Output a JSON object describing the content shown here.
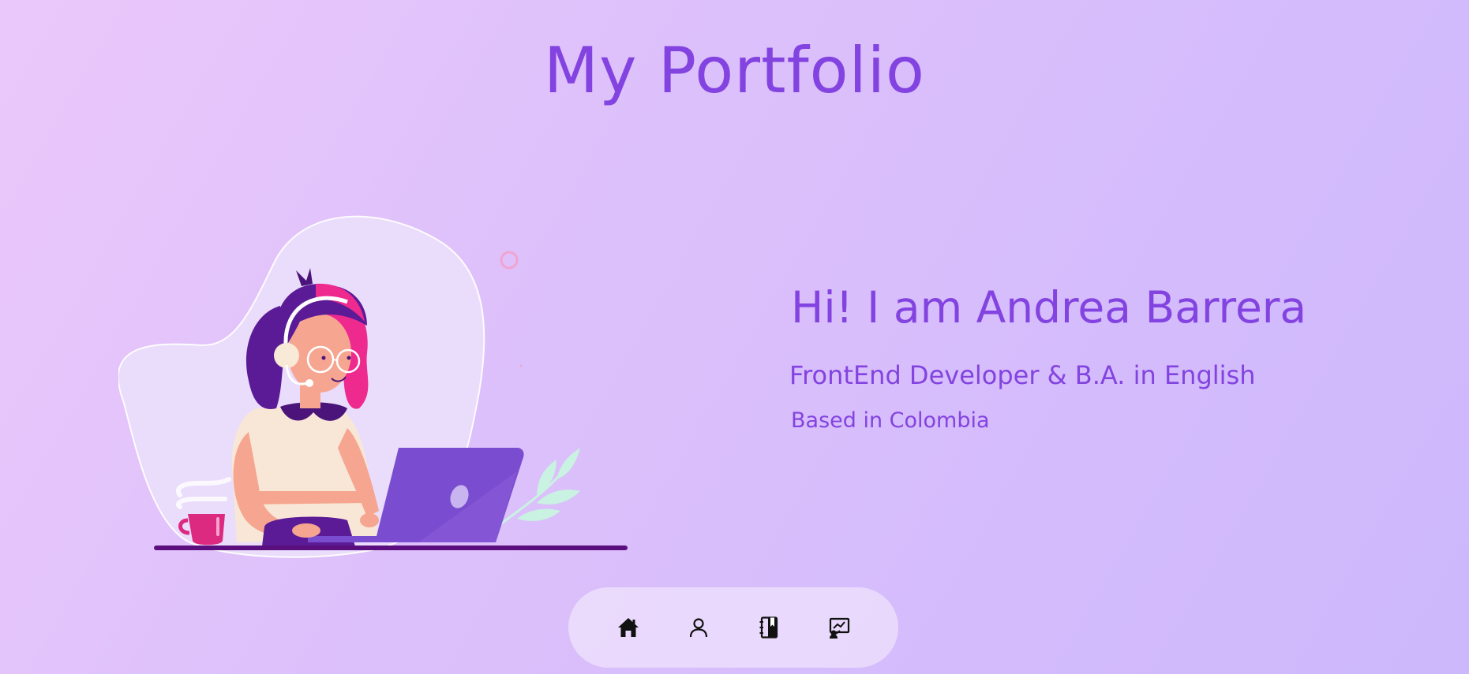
{
  "header": {
    "title": "My Portfolio"
  },
  "intro": {
    "name": "Hi! I am Andrea Barrera",
    "role": "FrontEnd Developer & B.A. in English",
    "location": "Based in Colombia"
  },
  "nav": {
    "items": [
      {
        "icon": "home-icon"
      },
      {
        "icon": "user-icon"
      },
      {
        "icon": "notebook-icon"
      },
      {
        "icon": "portfolio-icon"
      }
    ]
  },
  "colors": {
    "accent": "#8343e0",
    "background_start": "#ebc8fb",
    "background_end": "#cdb8fc",
    "nav_background": "#f3e8fc"
  }
}
